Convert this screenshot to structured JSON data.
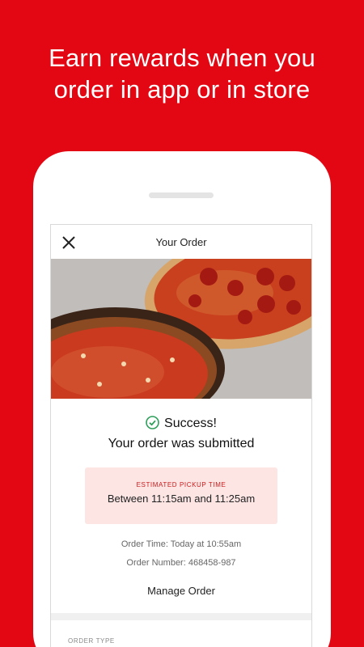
{
  "promo": {
    "headline_line1": "Earn rewards when you",
    "headline_line2": "order in app or in store"
  },
  "header": {
    "title": "Your Order",
    "close_icon": "close-icon"
  },
  "confirmation": {
    "success": "Success!",
    "message": "Your order was submitted",
    "check_icon": "check-circle-icon",
    "check_color": "#2e9e5b"
  },
  "pickup": {
    "label": "ESTIMATED PICKUP TIME",
    "time": "Between 11:15am and 11:25am"
  },
  "order": {
    "time": "Order Time: Today at 10:55am",
    "number": "Order Number: 468458-987"
  },
  "actions": {
    "manage_label": "Manage Order"
  },
  "details": {
    "order_type_label": "ORDER TYPE"
  },
  "colors": {
    "brand_red": "#e30613",
    "pickup_bg": "#fde5e4",
    "pickup_label": "#cc1a1a"
  }
}
